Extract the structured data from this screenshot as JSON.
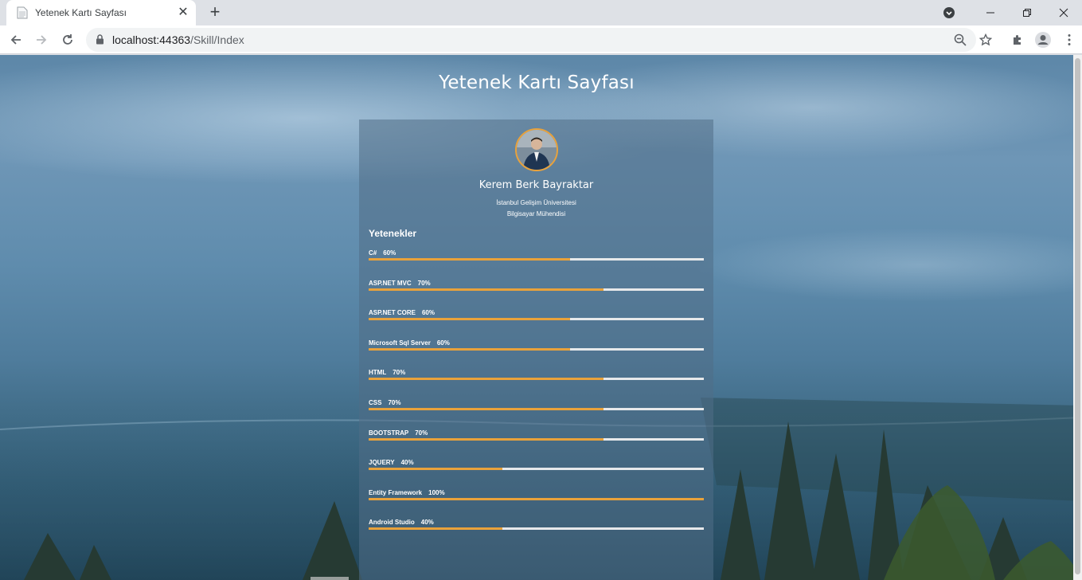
{
  "browser": {
    "tab_title": "Yetenek Kartı Sayfası",
    "url_host": "localhost:44363",
    "url_path": "/Skill/Index"
  },
  "page": {
    "title": "Yetenek Kartı Sayfası",
    "profile": {
      "name": "Kerem Berk Bayraktar",
      "university": "İstanbul Gelişim Üniversitesi",
      "profession": "Bilgisayar Mühendisi"
    },
    "skills_heading": "Yetenekler",
    "skills": [
      {
        "name": "C#",
        "percent_label": "60%",
        "value": 60
      },
      {
        "name": "ASP.NET MVC",
        "percent_label": "70%",
        "value": 70
      },
      {
        "name": "ASP.NET CORE",
        "percent_label": "60%",
        "value": 60
      },
      {
        "name": "Microsoft Sql Server",
        "percent_label": "60%",
        "value": 60
      },
      {
        "name": "HTML",
        "percent_label": "70%",
        "value": 70
      },
      {
        "name": "CSS",
        "percent_label": "70%",
        "value": 70
      },
      {
        "name": "BOOTSTRAP",
        "percent_label": "70%",
        "value": 70
      },
      {
        "name": "JQUERY",
        "percent_label": "40%",
        "value": 40
      },
      {
        "name": "Entity Framework",
        "percent_label": "100%",
        "value": 100
      },
      {
        "name": "Android Studio",
        "percent_label": "40%",
        "value": 40
      }
    ]
  },
  "colors": {
    "accent": "#e9a23b",
    "track": "#e6e8ea"
  }
}
